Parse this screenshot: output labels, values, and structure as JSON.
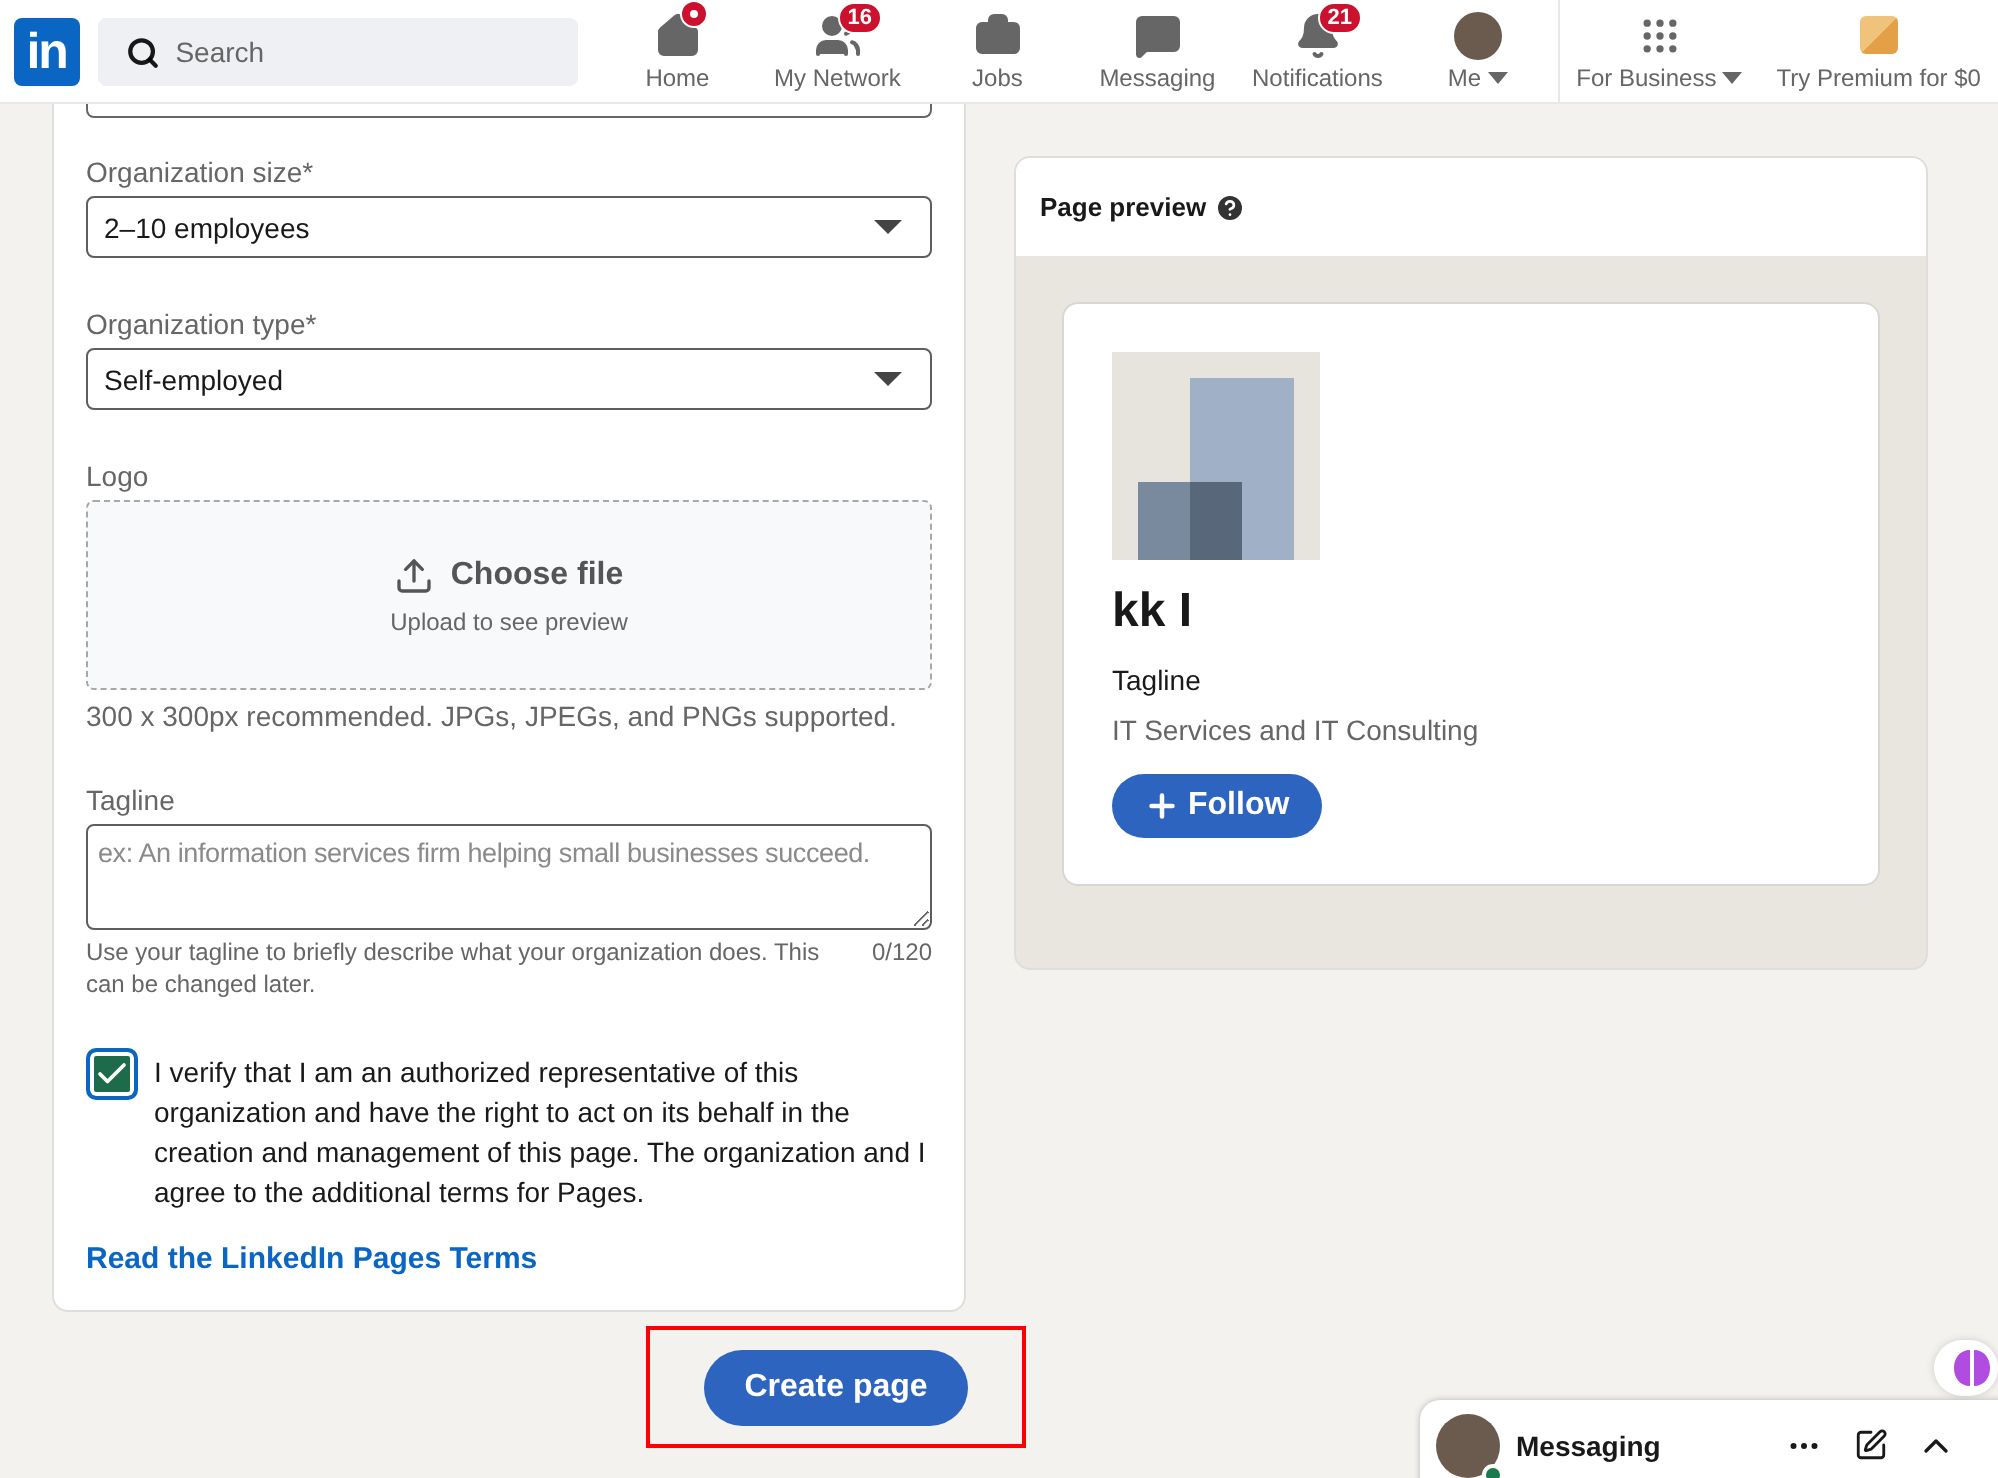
{
  "header": {
    "search": {
      "placeholder": "Search"
    },
    "logo": "in",
    "nav": [
      {
        "kind": "home",
        "label": "Home",
        "dot": true
      },
      {
        "kind": "network",
        "label": "My Network",
        "badge": "16",
        "dot": false
      },
      {
        "kind": "jobs",
        "label": "Jobs",
        "dot": false
      },
      {
        "kind": "messaging",
        "label": "Messaging",
        "dot": false
      },
      {
        "kind": "notifications",
        "label": "Notifications",
        "badge": "21",
        "dot": false
      },
      {
        "kind": "me",
        "label": "Me",
        "dot": false
      }
    ],
    "business": {
      "label": "For Business"
    },
    "premium": {
      "label": "Try Premium for $0"
    }
  },
  "form": {
    "fields": [
      {
        "label": "Organization size*",
        "value": "2–10 employees"
      },
      {
        "label": "Organization type*",
        "value": "Self-employed"
      }
    ],
    "logo": {
      "label": "Logo",
      "button": "Choose file",
      "hint": "Upload to see preview",
      "note": "300 x 300px recommended. JPGs, JPEGs, and PNGs supported."
    },
    "tagline": {
      "label": "Tagline",
      "placeholder": "ex: An information services firm helping small businesses succeed.",
      "help": "Use your tagline to briefly describe what your organization does. This can be changed later.",
      "counter": "0/120"
    },
    "verify": {
      "checked": true,
      "text": "I verify that I am an authorized representative of this organization and have the right to act on its behalf in the creation and management of this page. The organization and I agree to the additional terms for Pages."
    },
    "terms_link": "Read the LinkedIn Pages Terms"
  },
  "preview": {
    "title": "Page preview",
    "name": "kk I",
    "tagline": "Tagline",
    "industry": "IT Services and IT Consulting",
    "follow": "Follow"
  },
  "create_button": "Create page",
  "messaging": {
    "title": "Messaging",
    "online": true
  }
}
